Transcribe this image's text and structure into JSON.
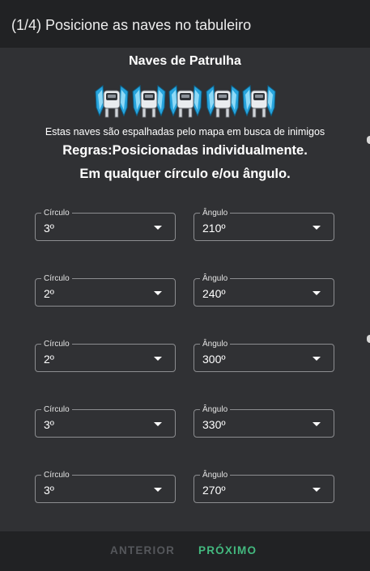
{
  "header": {
    "title": "(1/4) Posicione as naves no tabuleiro"
  },
  "content": {
    "subtitle": "Naves de Patrulha",
    "ship_icon": "patrol-ship-icon",
    "ship_count": 5,
    "description": "Estas naves são espalhadas pelo mapa em busca de inimigos",
    "rules_line1": "Regras:Posicionadas individualmente.",
    "rules_line2": "Em qualquer círculo e/ou ângulo."
  },
  "placements": [
    {
      "circle_label": "Círculo",
      "circle_value": "3º",
      "angle_label": "Ângulo",
      "angle_value": "210º"
    },
    {
      "circle_label": "Círculo",
      "circle_value": "2º",
      "angle_label": "Ângulo",
      "angle_value": "240º"
    },
    {
      "circle_label": "Círculo",
      "circle_value": "2º",
      "angle_label": "Ângulo",
      "angle_value": "300º"
    },
    {
      "circle_label": "Círculo",
      "circle_value": "3º",
      "angle_label": "Ângulo",
      "angle_value": "330º"
    },
    {
      "circle_label": "Círculo",
      "circle_value": "3º",
      "angle_label": "Ângulo",
      "angle_value": "270º"
    }
  ],
  "footer": {
    "prev_label": "ANTERIOR",
    "next_label": "PRÓXIMO"
  },
  "colors": {
    "accent": "#43b97f",
    "disabled": "#55575b",
    "surface": "#303134",
    "header": "#212224"
  }
}
